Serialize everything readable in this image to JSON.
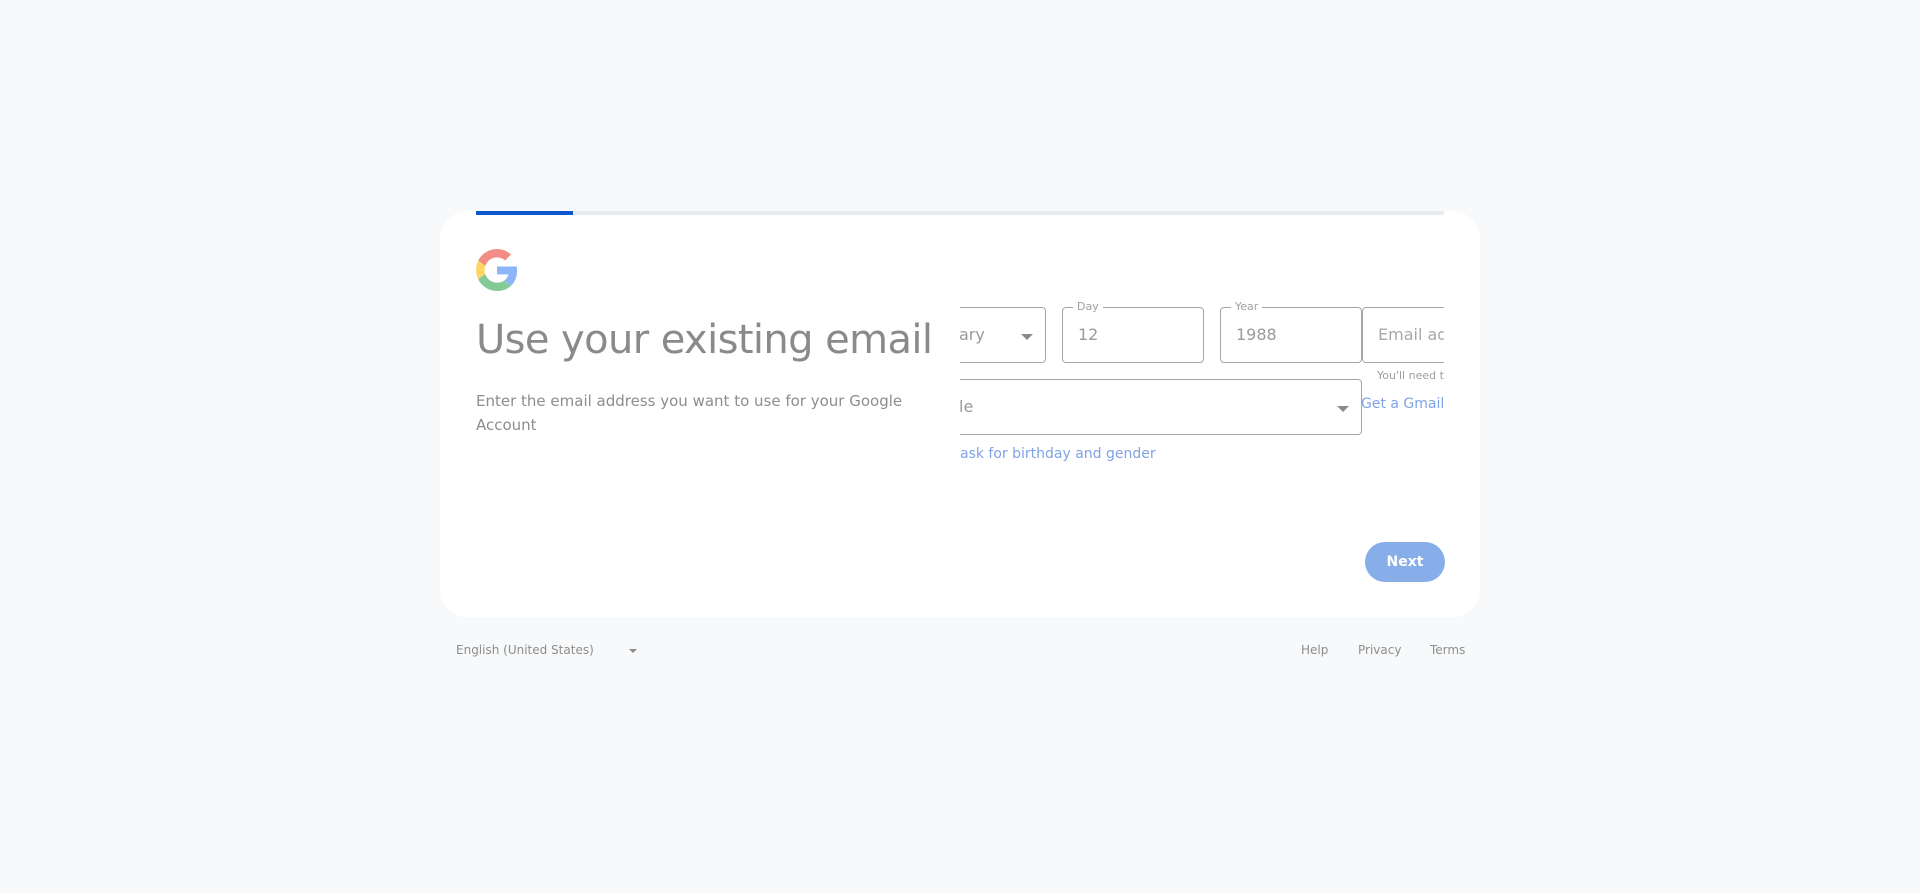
{
  "progress": {
    "fraction": 0.1,
    "fill_color": "#0b57d0"
  },
  "logo": {
    "icon": "google-g-icon",
    "colors": [
      "#4285f4",
      "#34a853",
      "#fbbc05",
      "#ea4335"
    ]
  },
  "heading": "Use your existing email",
  "subtext": "Enter the email address you want to use for your Google Account",
  "form": {
    "month": {
      "value": "ary"
    },
    "day": {
      "label": "Day",
      "value": "12"
    },
    "year": {
      "label": "Year",
      "value": "1988"
    },
    "email": {
      "placeholder": "Email add"
    },
    "email_helper": "You'll need t",
    "gender": {
      "value": "le"
    },
    "gmail_link": "Get a Gmail",
    "birthday_link": "ask for birthday and gender"
  },
  "next_button": "Next",
  "accent_color": "#0b57d0",
  "footer": {
    "language": "English (United States)",
    "links": {
      "help": "Help",
      "privacy": "Privacy",
      "terms": "Terms"
    }
  }
}
